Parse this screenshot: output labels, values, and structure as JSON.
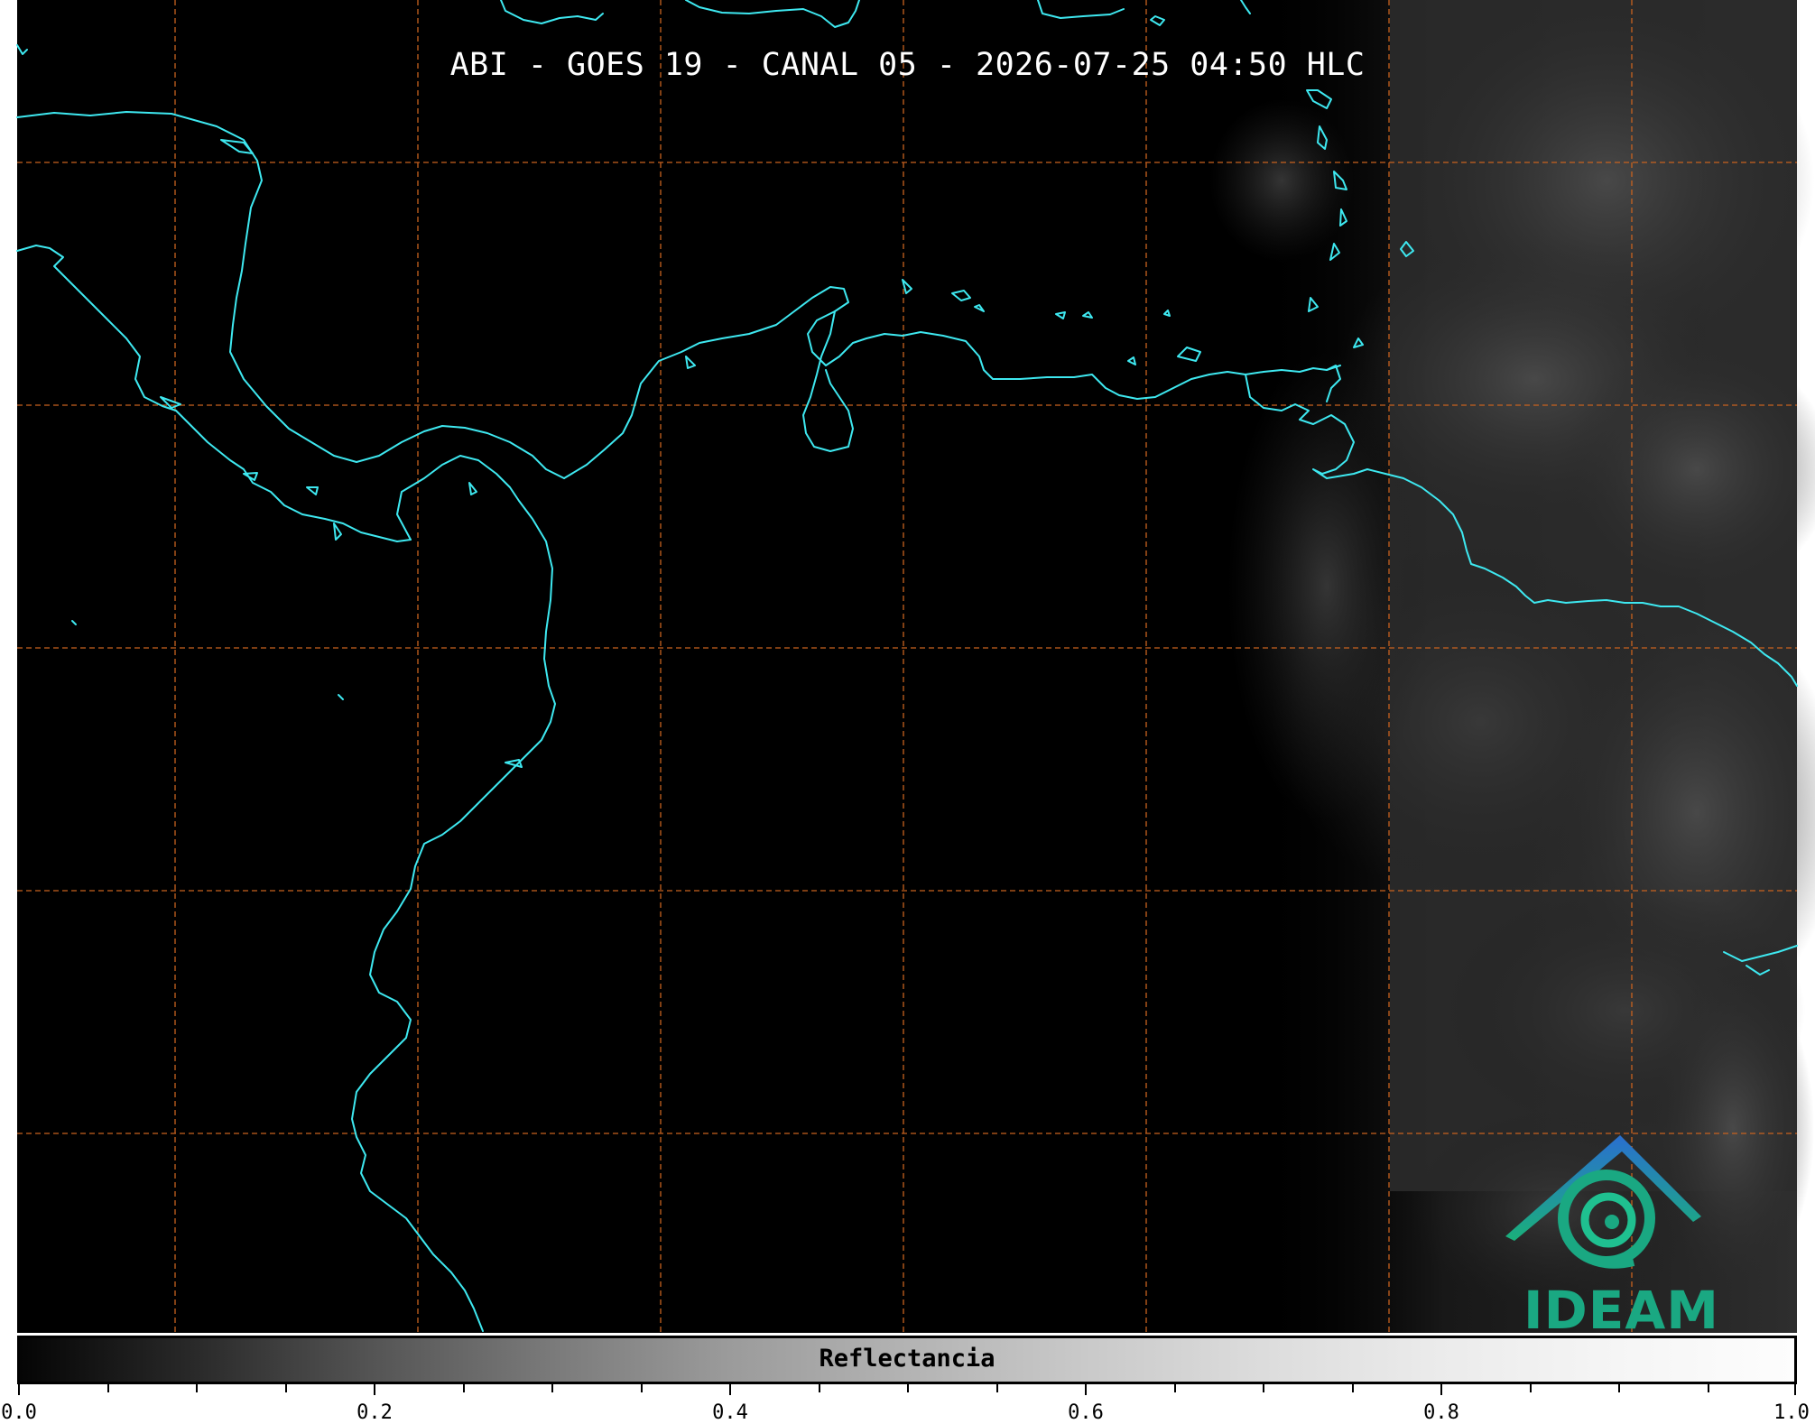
{
  "title": "ABI - GOES 19 - CANAL 05 - 2026-07-25 04:50 HLC",
  "logo": {
    "text": "IDEAM",
    "icon": "ideam-logo-icon",
    "color": "#1aa882"
  },
  "colors": {
    "background": "#000000",
    "coastline": "#3ee8f0",
    "grid": "#c8621f",
    "clouds": "#3a3a3a"
  },
  "colorbar": {
    "label": "Reflectancia",
    "range": [
      0.0,
      1.0
    ],
    "ticks": [
      "0.0",
      "0.2",
      "0.4",
      "0.6",
      "0.8",
      "1.0"
    ]
  }
}
